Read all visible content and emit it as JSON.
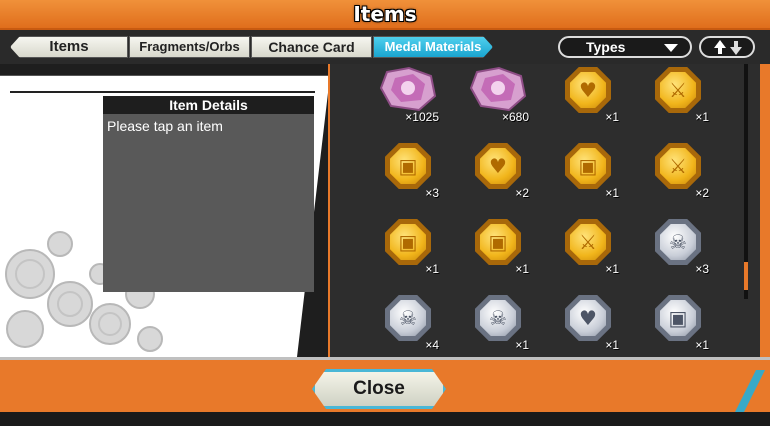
{
  "title": "Items",
  "tabs": [
    {
      "label": "Items",
      "active": false
    },
    {
      "label": "Fragments/Orbs",
      "active": false
    },
    {
      "label": "Chance Card",
      "active": false
    },
    {
      "label": "Medal Materials",
      "active": true
    }
  ],
  "filter": {
    "selected": "Types"
  },
  "details": {
    "header": "Item Details",
    "message": "Please tap an item"
  },
  "items": [
    {
      "kind": "shard",
      "qty": "×1025"
    },
    {
      "kind": "shard",
      "qty": "×680"
    },
    {
      "kind": "gold",
      "icon": "heart",
      "qty": "×1"
    },
    {
      "kind": "gold",
      "icon": "sword",
      "qty": "×1"
    },
    {
      "kind": "gold",
      "icon": "armor",
      "qty": "×3"
    },
    {
      "kind": "gold",
      "icon": "heart",
      "qty": "×2"
    },
    {
      "kind": "gold",
      "icon": "armor",
      "qty": "×1"
    },
    {
      "kind": "gold",
      "icon": "sword",
      "qty": "×2"
    },
    {
      "kind": "gold",
      "icon": "armor",
      "qty": "×1"
    },
    {
      "kind": "gold",
      "icon": "armor",
      "qty": "×1"
    },
    {
      "kind": "gold",
      "icon": "sword",
      "qty": "×1"
    },
    {
      "kind": "silver",
      "icon": "skull",
      "qty": "×3"
    },
    {
      "kind": "silver",
      "icon": "skull",
      "qty": "×4"
    },
    {
      "kind": "silver",
      "icon": "skull",
      "qty": "×1"
    },
    {
      "kind": "silver",
      "icon": "heart",
      "qty": "×1"
    },
    {
      "kind": "silver",
      "icon": "armor",
      "qty": "×1"
    }
  ],
  "close_label": "Close",
  "colors": {
    "accent": "#e8792a",
    "active_tab": "#1aa4cf",
    "panel": "#2d2d2d"
  }
}
